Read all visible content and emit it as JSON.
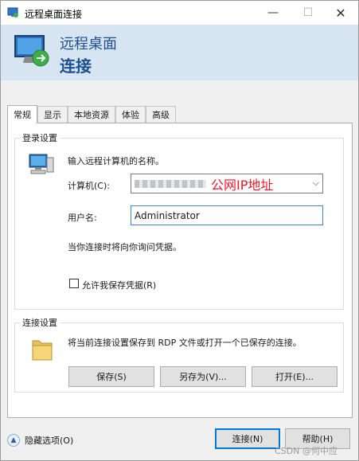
{
  "window": {
    "title": "远程桌面连接",
    "min": "—",
    "max": "☐",
    "close": "✕"
  },
  "banner": {
    "line1": "远程桌面",
    "line2": "连接"
  },
  "tabs": [
    "常规",
    "显示",
    "本地资源",
    "体验",
    "高级"
  ],
  "login": {
    "group_title": "登录设置",
    "prompt": "输入远程计算机的名称。",
    "computer_label": "计算机(C):",
    "computer_value": "公网IP地址",
    "username_label": "用户名:",
    "username_value": "Administrator",
    "note": "当你连接时将向你询问凭据。",
    "allow_save_label": "允许我保存凭据(R)",
    "allow_save_checked": false
  },
  "connection": {
    "group_title": "连接设置",
    "description": "将当前连接设置保存到 RDP 文件或打开一个已保存的连接。",
    "save": "保存(S)",
    "save_as": "另存为(V)...",
    "open": "打开(E)..."
  },
  "footer": {
    "toggle_label": "隐藏选项(O)",
    "connect": "连接(N)",
    "help": "帮助(H)",
    "watermark": "CSDN @何中应"
  },
  "colors": {
    "accent": "#0078d7",
    "banner_text": "#1e4f8f",
    "annotation_red": "#e8182c"
  }
}
